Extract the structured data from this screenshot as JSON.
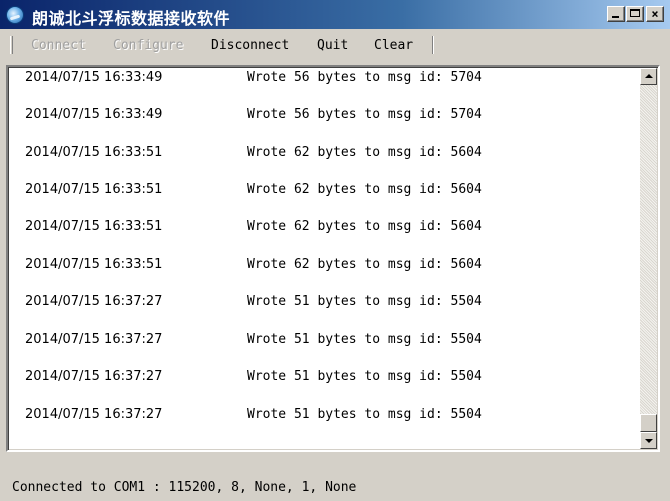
{
  "window": {
    "title": "朗诚北斗浮标数据接收软件",
    "app_icon": "globe-icon",
    "controls": {
      "minimize": "_",
      "maximize": "□",
      "close": "×"
    }
  },
  "menu": {
    "connect": "Connect",
    "configure": "Configure",
    "disconnect": "Disconnect",
    "quit": "Quit",
    "clear": "Clear"
  },
  "log": {
    "rows": [
      {
        "timestamp": "2014/07/15 16:33:49",
        "message": "Wrote 56 bytes to msg id: 5704"
      },
      {
        "timestamp": "2014/07/15 16:33:49",
        "message": "Wrote 56 bytes to msg id: 5704"
      },
      {
        "timestamp": "2014/07/15 16:33:51",
        "message": "Wrote 62 bytes to msg id: 5604"
      },
      {
        "timestamp": "2014/07/15 16:33:51",
        "message": "Wrote 62 bytes to msg id: 5604"
      },
      {
        "timestamp": "2014/07/15 16:33:51",
        "message": "Wrote 62 bytes to msg id: 5604"
      },
      {
        "timestamp": "2014/07/15 16:33:51",
        "message": "Wrote 62 bytes to msg id: 5604"
      },
      {
        "timestamp": "2014/07/15 16:37:27",
        "message": "Wrote 51 bytes to msg id: 5504"
      },
      {
        "timestamp": "2014/07/15 16:37:27",
        "message": "Wrote 51 bytes to msg id: 5504"
      },
      {
        "timestamp": "2014/07/15 16:37:27",
        "message": "Wrote 51 bytes to msg id: 5504"
      },
      {
        "timestamp": "2014/07/15 16:37:27",
        "message": "Wrote 51 bytes to msg id: 5504"
      }
    ]
  },
  "status": {
    "text": "Connected to COM1 : 115200, 8, None, 1, None"
  },
  "colors": {
    "titlebar_start": "#0a246a",
    "titlebar_end": "#a6caf0",
    "face": "#d4d0c8",
    "disabled_text": "#a0a0a0"
  }
}
